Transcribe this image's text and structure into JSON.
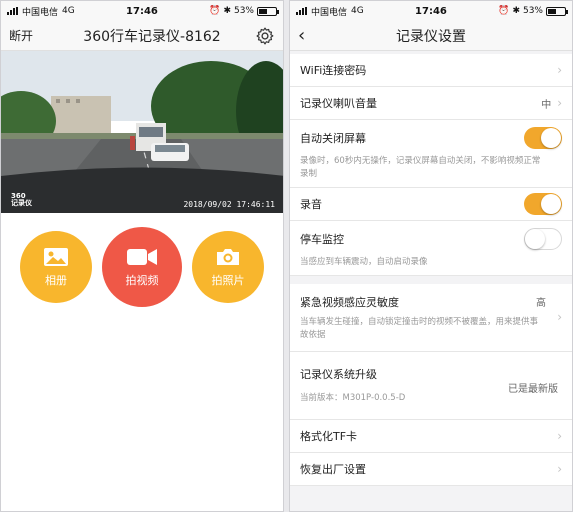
{
  "left": {
    "status": {
      "carrier": "中国电信",
      "network": "4G",
      "time": "17:46",
      "battery": "53%"
    },
    "nav": {
      "left_label": "断开",
      "title": "360行车记录仪-8162",
      "settings_icon": "gear-icon"
    },
    "video": {
      "logo_line1": "360",
      "logo_line2": "记录仪",
      "timestamp": "2018/09/02  17:46:11"
    },
    "actions": [
      {
        "label": "相册",
        "icon": "image-icon",
        "color": "#f8b62d"
      },
      {
        "label": "拍视频",
        "icon": "video-camera-icon",
        "color": "#ef5847"
      },
      {
        "label": "拍照片",
        "icon": "camera-icon",
        "color": "#f8b62d"
      }
    ]
  },
  "right": {
    "status": {
      "carrier": "中国电信",
      "network": "4G",
      "time": "17:46",
      "battery": "53%"
    },
    "nav": {
      "back_icon": "back-chevron-icon",
      "title": "记录仪设置"
    },
    "settings": [
      {
        "label": "WiFi连接密码"
      },
      {
        "label": "记录仪喇叭音量",
        "value": "中"
      },
      {
        "label": "自动关闭屏幕",
        "toggle": true,
        "desc": "录像时，60秒内无操作，记录仪屏幕自动关闭，不影响视频正常录制"
      },
      {
        "label": "录音",
        "toggle": true
      },
      {
        "label": "停车监控",
        "toggle": false,
        "desc": "当感应到车辆震动，自动启动录像"
      },
      {
        "label": "紧急视频感应灵敏度",
        "value": "高",
        "desc": "当车辆发生碰撞，自动锁定撞击时的视频不被覆盖，用来提供事故依据"
      },
      {
        "label": "记录仪系统升级",
        "value": "已是最新版",
        "desc": "当前版本：M301P-0.0.5-D"
      },
      {
        "label": "格式化TF卡"
      },
      {
        "label": "恢复出厂设置"
      }
    ],
    "accent_color": "#f1a72c"
  }
}
